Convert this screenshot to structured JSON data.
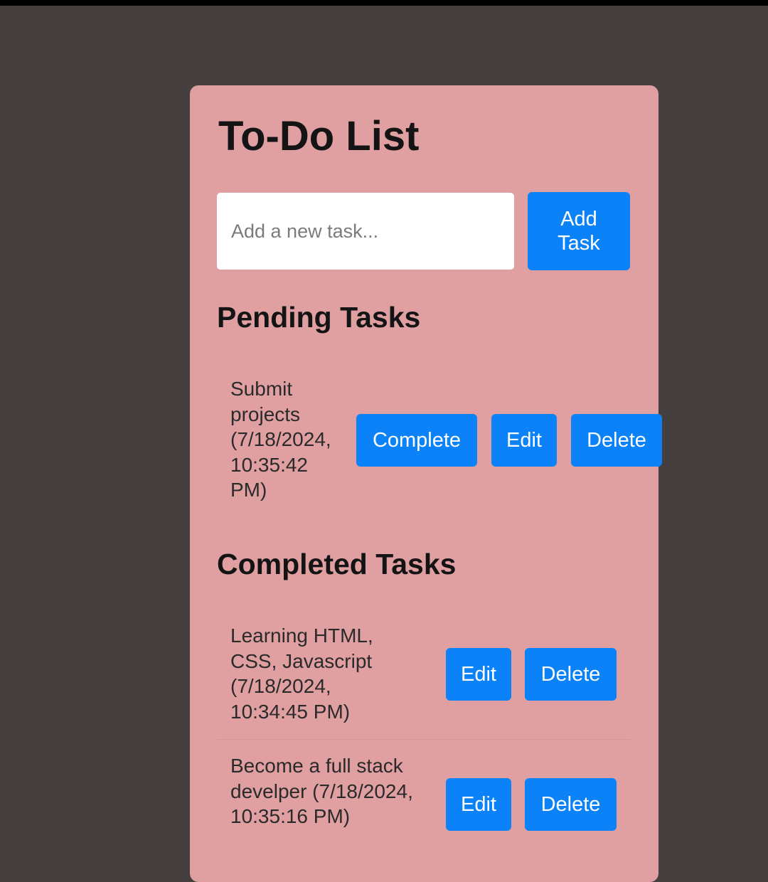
{
  "app": {
    "title": "To-Do List"
  },
  "input": {
    "placeholder": "Add a new task...",
    "value": ""
  },
  "add_button": {
    "label": "Add Task"
  },
  "pending": {
    "heading": "Pending Tasks",
    "tasks": [
      {
        "text": "Submit projects (7/18/2024, 10:35:42 PM)",
        "complete_label": "Complete",
        "edit_label": "Edit",
        "delete_label": "Delete"
      }
    ]
  },
  "completed": {
    "heading": "Completed Tasks",
    "tasks": [
      {
        "text": "Learning HTML, CSS, Javascript (7/18/2024, 10:34:45 PM)",
        "edit_label": "Edit",
        "delete_label": "Delete"
      },
      {
        "text": "Become a full stack develper (7/18/2024, 10:35:16 PM)",
        "edit_label": "Edit",
        "delete_label": "Delete"
      }
    ]
  },
  "colors": {
    "page_background": "#463f40",
    "card_background": "#e0a0a2",
    "button": "#0b82f8",
    "button_text": "#ffffff"
  }
}
